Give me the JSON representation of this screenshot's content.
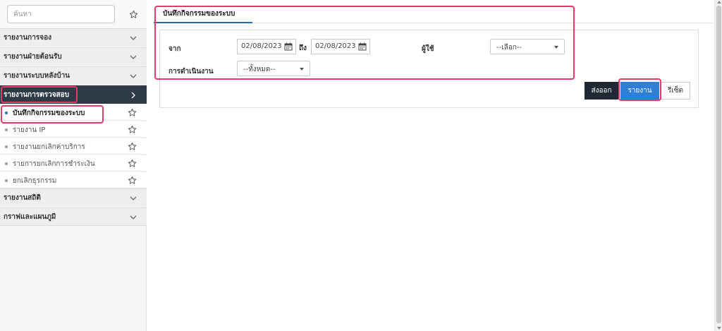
{
  "sidebar": {
    "search_placeholder": "ค้นหา",
    "groups": [
      {
        "label": "รายงานการจอง"
      },
      {
        "label": "รายงานฝ่ายต้อนรับ"
      },
      {
        "label": "รายงานระบบหลังบ้าน"
      },
      {
        "label": "รายงานการตรวจสอบ"
      },
      {
        "label": "รายงานสถิติ"
      },
      {
        "label": "กราฟและแผนภูมิ"
      }
    ],
    "sub_items": [
      {
        "label": "บันทึกกิจกรรมของระบบ"
      },
      {
        "label": "รายงาน IP"
      },
      {
        "label": "รายงานยกเลิกค่าบริการ"
      },
      {
        "label": "รายการยกเลิกการชำระเงิน"
      },
      {
        "label": "ยกเลิกธุรกรรม"
      }
    ]
  },
  "main": {
    "tab_label": "บันทึกกิจกรรมของระบบ",
    "filters": {
      "from_label": "จาก",
      "from_value": "02/08/2023",
      "to_label": "ถึง",
      "to_value": "02/08/2023",
      "user_label": "ผู้ใช้",
      "user_value": "--เลือก--",
      "operation_label": "การดำเนินงาน",
      "operation_value": "--ทั้งหมด--"
    },
    "buttons": {
      "export": "ส่งออก",
      "report": "รายงาน",
      "reset": "รีเซ็ต"
    }
  },
  "colors": {
    "highlight": "#e53a6a",
    "active_group_bg": "#2f3a47",
    "primary": "#2e7fd6",
    "dark_button": "#1f2833"
  }
}
